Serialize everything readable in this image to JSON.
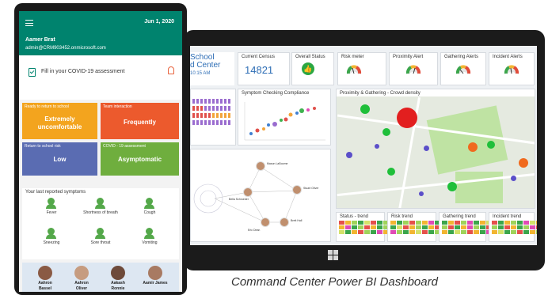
{
  "caption": "Command Center Power BI Dashboard",
  "phone": {
    "date": "Jun 1, 2020",
    "user_name": "Aamer Brat",
    "user_email": "admin@CRM903452.onmicrosoft.com",
    "covid_prompt": "Fill in your COVID-19 assessment",
    "tiles": [
      {
        "label": "Ready to return to school",
        "value": "Extremely uncomfortable",
        "color": "#f3a41e"
      },
      {
        "label": "Team interaction",
        "value": "Frequently",
        "color": "#ec5a2d"
      },
      {
        "label": "Return to school risk",
        "value": "Low",
        "color": "#5a6cb2"
      },
      {
        "label": "COVID - 19 assessment",
        "value": "Asymptomatic",
        "color": "#6fae3e"
      }
    ],
    "symptoms_title": "Your last reported symptoms",
    "symptoms": [
      "Fever",
      "Shortness of breath",
      "Cough",
      "Sneezing",
      "Sore throat",
      "Vomiting"
    ],
    "people": [
      {
        "first": "Aahron",
        "last": "Bassel"
      },
      {
        "first": "Aahron",
        "last": "Oliver"
      },
      {
        "first": "Aakash",
        "last": "Ronnie"
      },
      {
        "first": "Aamir James",
        "last": ""
      }
    ]
  },
  "dashboard": {
    "school_title_line1": "School",
    "school_title_line2": "d Center",
    "school_time": "10:15 AM",
    "census_label": "Current Census",
    "census_value": "14821",
    "overall_status_label": "Overall Status",
    "risk_meter_label": "Risk meter",
    "proximity_alert_label": "Proximity Alert",
    "gathering_alerts_label": "Gathering Alerts",
    "incident_alerts_label": "Incident Alerts",
    "compliance_label": "Symptom Checking Compliance",
    "map_label": "Proximity & Gathering - Crowd density",
    "status_trend_label": "Status - trend",
    "risk_trend_label": "Risk trend",
    "gathering_trend_label": "Gathering trend",
    "incident_trend_label": "Incident trend",
    "network_people": [
      {
        "name": "Mason LaBoome",
        "role": "Related Person"
      },
      {
        "name": "Bella Schroeder",
        "role": "Related Person"
      },
      {
        "name": "Stuart Oliver",
        "role": "Related Person"
      },
      {
        "name": "Eric Dean",
        "role": "Related Person"
      },
      {
        "name": "Brett Hall",
        "role": "Related Person"
      }
    ]
  },
  "colors": {
    "teal": "#00836e",
    "kpi_blue": "#2d6db5",
    "ok_green": "#2aa742"
  }
}
